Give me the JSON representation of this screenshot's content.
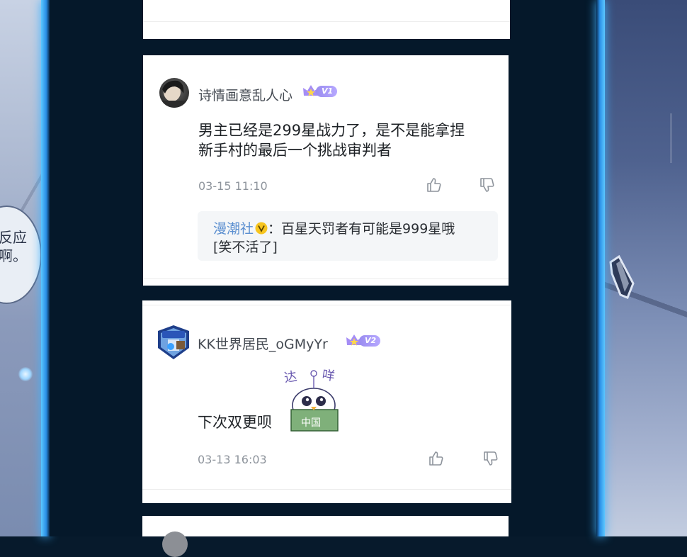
{
  "side_left": {
    "bubble_text": "反应\n啊。"
  },
  "comments": [
    {
      "username": "诗情画意乱人心",
      "level": "V1",
      "content_line1": "男主已经是299星战力了，是不是能拿捏",
      "content_line2": "新手村的最后一个挑战审判者",
      "timestamp": "03-15 11:10",
      "reply": {
        "author": "漫潮社",
        "verified_icon": "v-verified-icon",
        "text_line1": "：百星天罚者有可能是999星哦",
        "text_line2": "[笑不活了]"
      }
    },
    {
      "username": "KK世界居民_oGMyYr",
      "level": "V2",
      "content": "下次双更呗",
      "sticker": {
        "top_text_left": "达",
        "top_text_right": "咩",
        "bottom_text": "中国"
      },
      "timestamp": "03-13 16:03"
    }
  ],
  "icons": {
    "like": "thumbs-up-icon",
    "dislike": "thumbs-down-icon"
  },
  "colors": {
    "accent_blue": "#3fb2ff",
    "vip_purple": "#9a8cf0",
    "reply_author": "#5b8fd0"
  }
}
